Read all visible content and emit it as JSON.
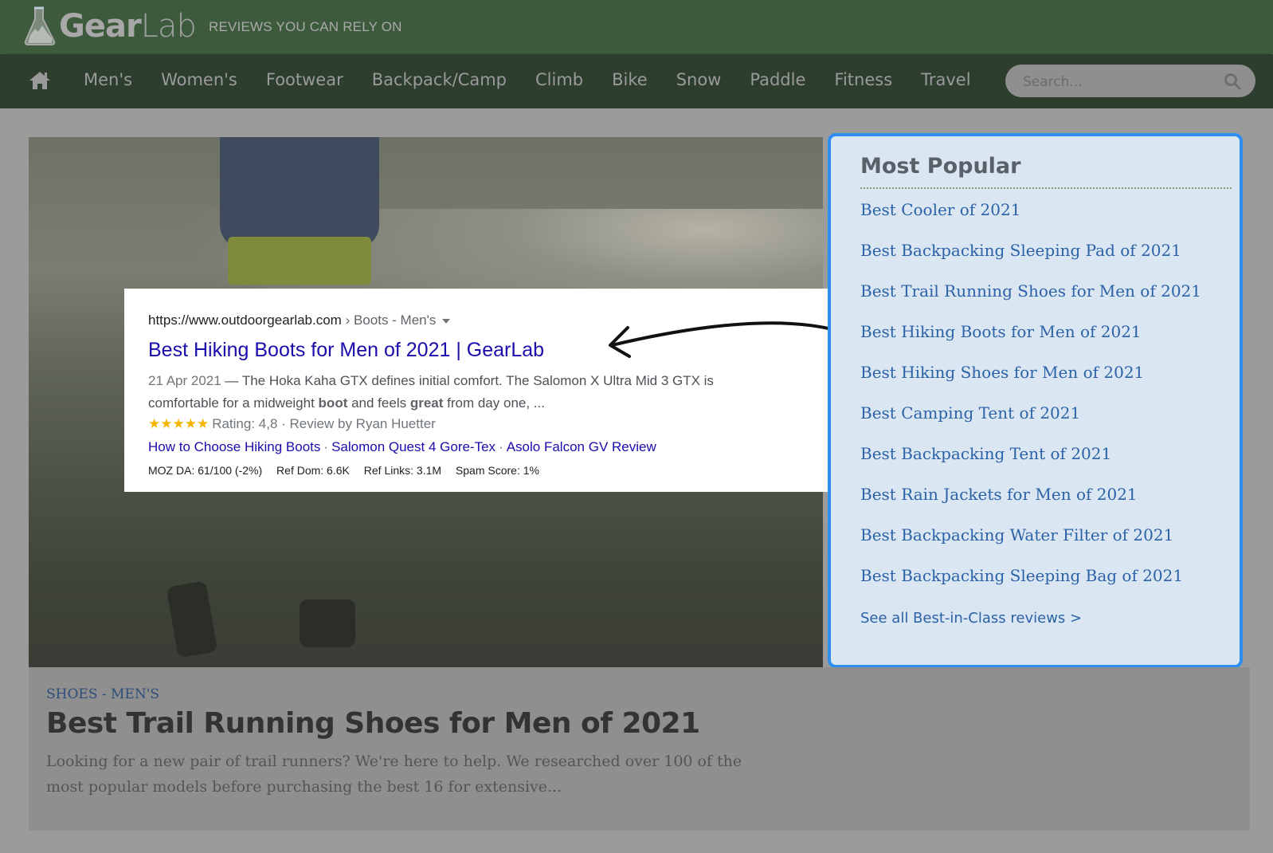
{
  "header": {
    "logo_bold": "Gear",
    "logo_light": "Lab",
    "tagline": "REVIEWS YOU CAN RELY ON"
  },
  "nav": {
    "home_icon": "home-icon",
    "items": [
      "Men's",
      "Women's",
      "Footwear",
      "Backpack/Camp",
      "Climb",
      "Bike",
      "Snow",
      "Paddle",
      "Fitness",
      "Travel"
    ],
    "search_placeholder": "Search...",
    "search_icon": "search-icon"
  },
  "serp": {
    "url": "https://www.outdoorgearlab.com",
    "breadcrumb": " › Boots - Men's",
    "title": "Best Hiking Boots for Men of 2021 | GearLab",
    "date": "21 Apr 2021",
    "snippet_1": " — The Hoka Kaha GTX defines initial comfort. The Salomon X Ultra Mid 3 GTX is comfortable for a midweight ",
    "snippet_bold_1": "boot",
    "snippet_2": " and feels ",
    "snippet_bold_2": "great",
    "snippet_3": " from day one, ...",
    "stars": "★★★★★",
    "rating_text": "Rating: 4,8 · Review by Ryan Huetter",
    "rating_value": 4.8,
    "sitelinks": [
      "How to Choose Hiking Boots",
      "Salomon Quest 4 Gore-Tex",
      "Asolo Falcon GV Review"
    ],
    "moz": {
      "da": "MOZ DA: 61/100 (-2%)",
      "ref_dom": "Ref Dom: 6.6K",
      "ref_links": "Ref Links: 3.1M",
      "spam": "Spam Score: 1%"
    }
  },
  "popular": {
    "title": "Most Popular",
    "items": [
      "Best Cooler of 2021",
      "Best Backpacking Sleeping Pad of 2021",
      "Best Trail Running Shoes for Men of 2021",
      "Best Hiking Boots for Men of 2021",
      "Best Hiking Shoes for Men of 2021",
      "Best Camping Tent of 2021",
      "Best Backpacking Tent of 2021",
      "Best Rain Jackets for Men of 2021",
      "Best Backpacking Water Filter of 2021",
      "Best Backpacking Sleeping Bag of 2021"
    ],
    "see_all": "See all Best-in-Class reviews >",
    "accent_color": "#2f8ff0"
  },
  "article": {
    "category": "SHOES - MEN'S",
    "title": "Best Trail Running Shoes for Men of 2021",
    "description": "Looking for a new pair of trail runners? We're here to help. We researched over 100 of the most popular models before purchasing the best 16 for extensive..."
  }
}
